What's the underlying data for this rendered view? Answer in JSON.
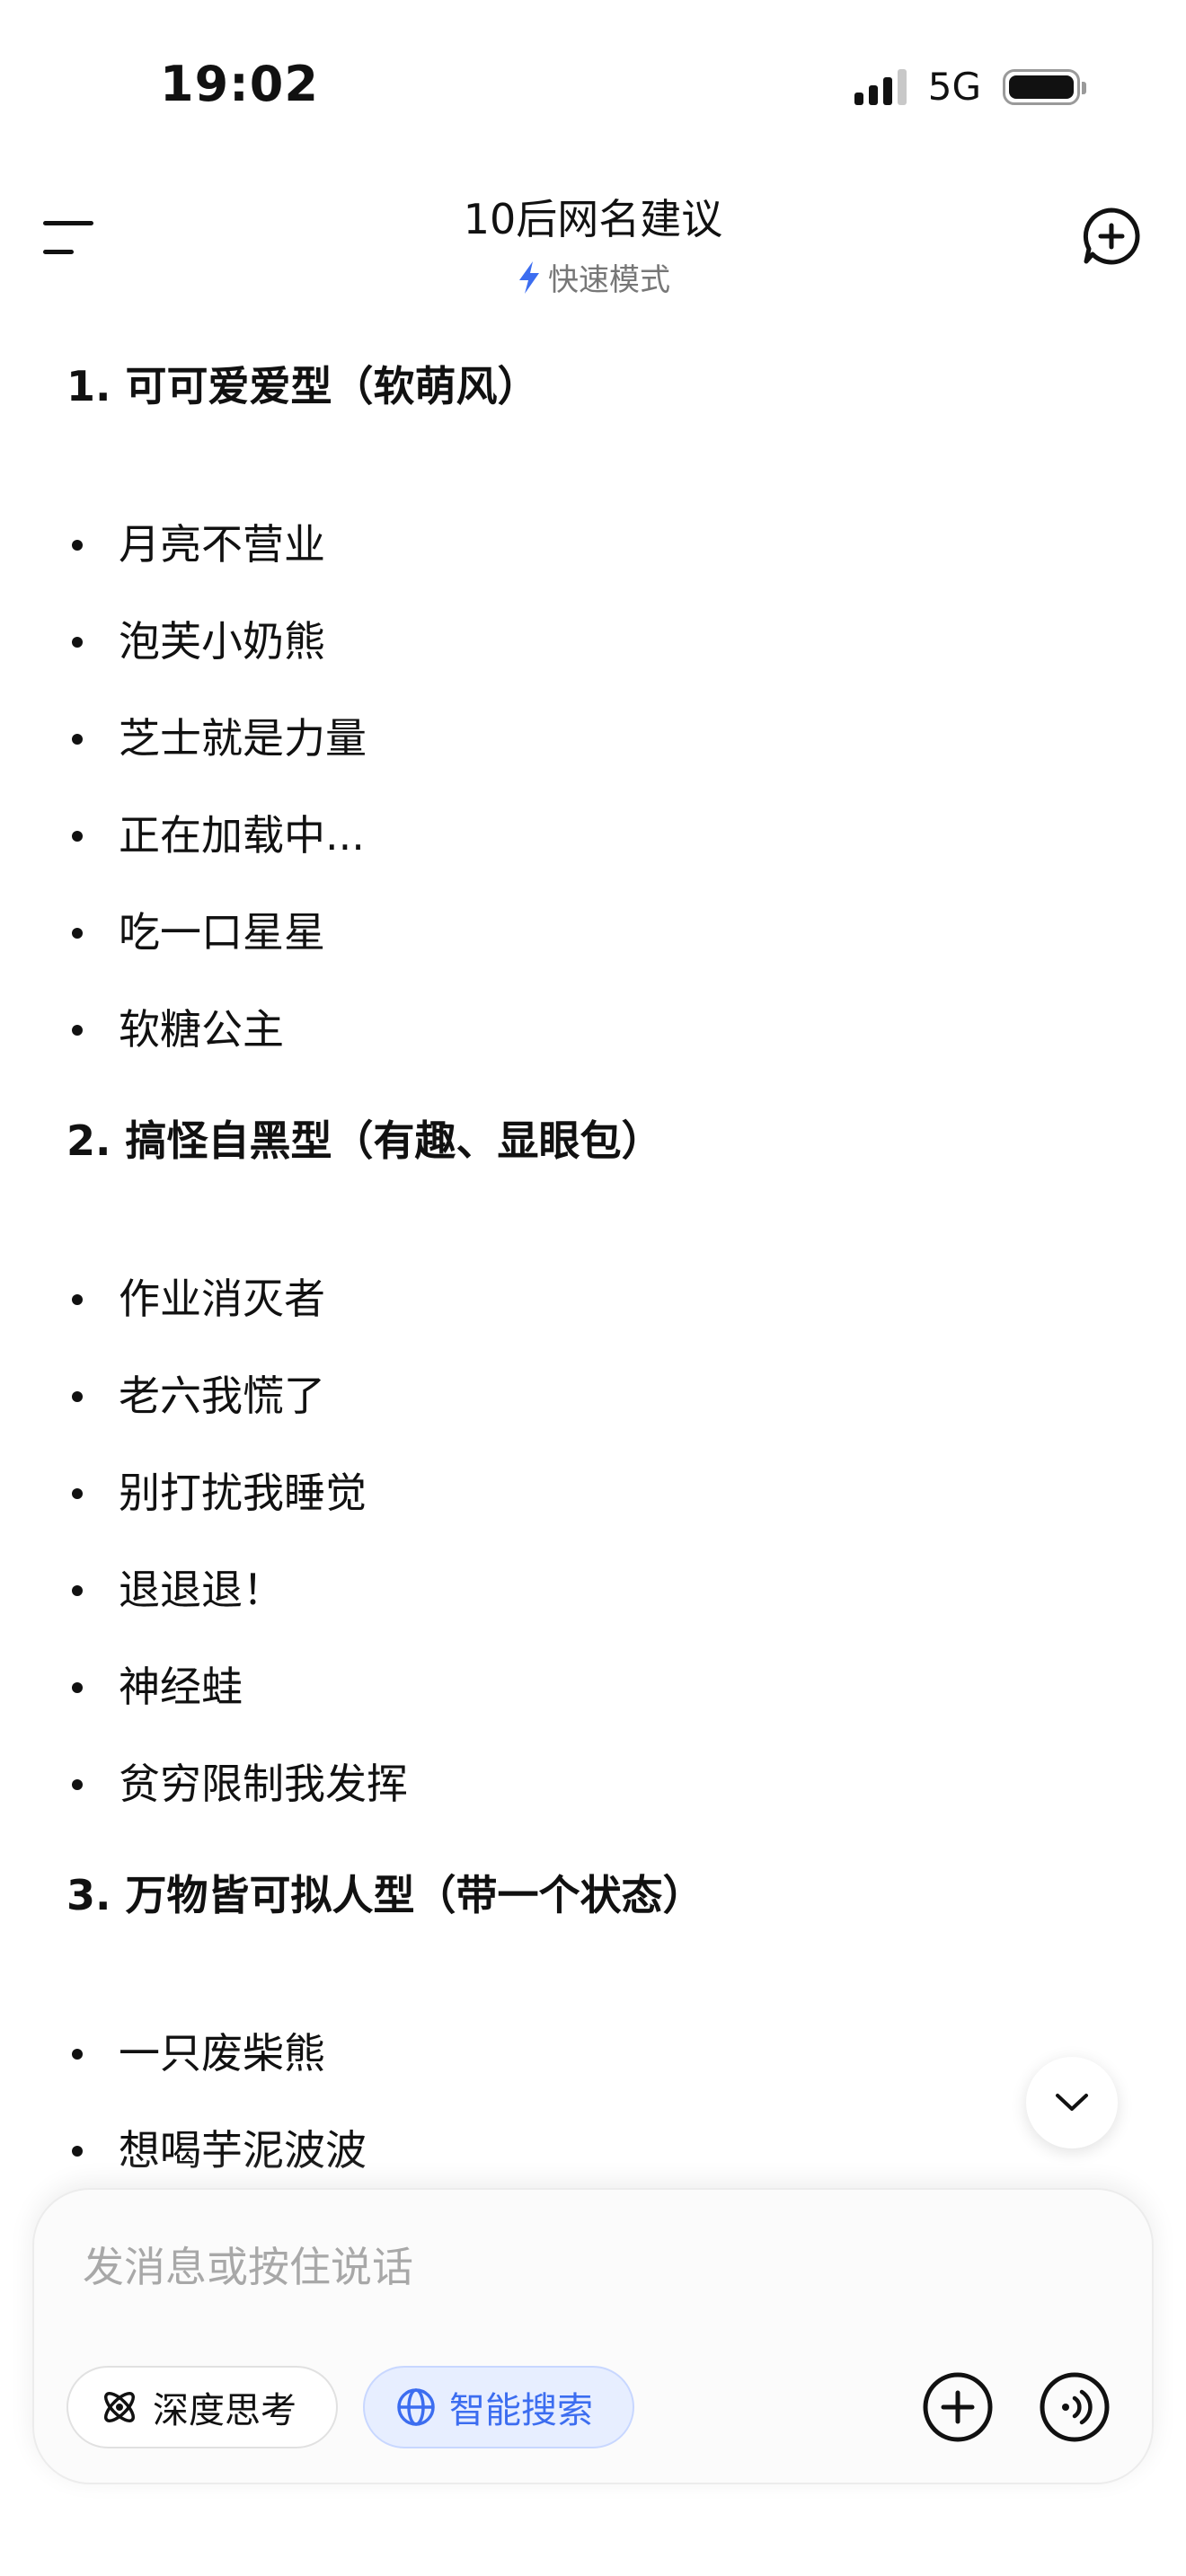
{
  "status_bar": {
    "time": "19:02",
    "network": "5G"
  },
  "header": {
    "title": "10后网名建议",
    "mode": "快速模式",
    "icons": [
      "menu-icon",
      "new-chat-icon",
      "bolt-icon"
    ]
  },
  "sections": [
    {
      "heading": "1. 可可爱爱型（软萌风）",
      "items": [
        "月亮不营业",
        "泡芙小奶熊",
        "芝士就是力量",
        "正在加载中...",
        "吃一口星星",
        "软糖公主"
      ]
    },
    {
      "heading": "2. 搞怪自黑型（有趣、显眼包）",
      "items": [
        "作业消灭者",
        "老六我慌了",
        "别打扰我睡觉",
        "退退退！",
        "神经蛙",
        "贫穷限制我发挥"
      ]
    },
    {
      "heading": "3. 万物皆可拟人型（带一个状态）",
      "items": [
        "一只废柴熊",
        "想喝芋泥波波"
      ]
    }
  ],
  "composer": {
    "placeholder": "发消息或按住说话",
    "deep_think_label": "深度思考",
    "smart_search_label": "智能搜索",
    "accent_color": "#3c6df0"
  }
}
